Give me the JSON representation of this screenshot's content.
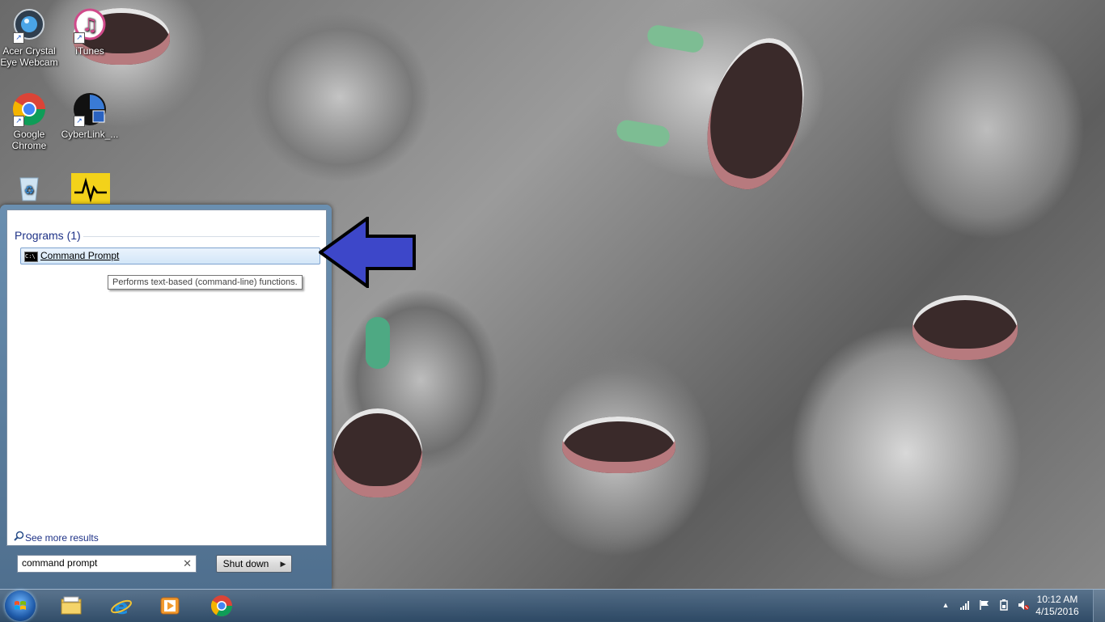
{
  "desktop": {
    "icons": [
      {
        "label": "Acer Crystal Eye Webcam"
      },
      {
        "label": "iTunes"
      },
      {
        "label": "Google Chrome"
      },
      {
        "label": "CyberLink_..."
      },
      {
        "label": ""
      },
      {
        "label": ""
      }
    ]
  },
  "start_menu": {
    "programs_header": "Programs (1)",
    "result_label": "Command Prompt",
    "tooltip": "Performs text-based (command-line) functions.",
    "see_more": "See more results",
    "search_value": "command prompt",
    "shutdown_label": "Shut down"
  },
  "taskbar": {
    "pinned": [
      "windows-explorer-icon",
      "internet-explorer-icon",
      "media-player-icon",
      "chrome-icon"
    ],
    "clock_time": "10:12 AM",
    "clock_date": "4/15/2016"
  },
  "colors": {
    "arrow": "#3d47c9",
    "highlight_border": "#7da2ce",
    "programs_header": "#1e3287"
  }
}
